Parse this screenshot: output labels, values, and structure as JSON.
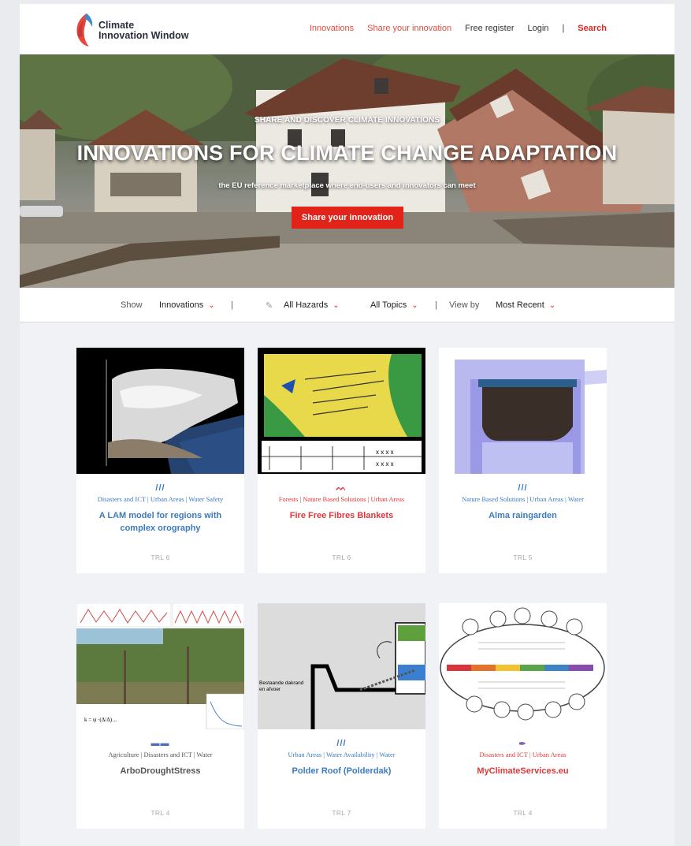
{
  "header": {
    "logo_line1": "Climate",
    "logo_line2": "Innovation Window",
    "nav": {
      "innovations": "Innovations",
      "share": "Share your innovation",
      "register": "Free register",
      "login": "Login",
      "separator": "|",
      "search": "Search"
    }
  },
  "hero": {
    "kicker": "SHARE AND DISCOVER CLIMATE INNOVATIONS",
    "title": "INNOVATIONS FOR CLIMATE CHANGE ADAPTATION",
    "subtitle": "the EU reference marketplace where end-users and innovators can meet",
    "button": "Share your innovation"
  },
  "filters": {
    "show_label": "Show",
    "show_value": "Innovations",
    "separator": "|",
    "hazards_value": "All Hazards",
    "topics_value": "All Topics",
    "view_label": "View by",
    "view_value": "Most Recent",
    "chevron": "⌄"
  },
  "cards": [
    {
      "hazard_icon": "///",
      "tags": "Disasters and ICT | Urban Areas | Water Safety",
      "title": "A LAM model for regions with complex orography",
      "trl": "TRL 6"
    },
    {
      "hazard_icon": "ᨓ",
      "tags": "Forests | Nature Based Solutions | Urban Areas",
      "title": "Fire Free Fibres Blankets",
      "trl": "TRL 6"
    },
    {
      "hazard_icon": "///",
      "tags": "Nature Based Solutions | Urban Areas | Water",
      "title": "Alma raingarden",
      "trl": "TRL 5"
    },
    {
      "hazard_icon": "▬▬",
      "tags": "Agriculture | Disasters and ICT | Water",
      "title": "ArboDroughtStress",
      "trl": "TRL 4"
    },
    {
      "hazard_icon": "///",
      "tags": "Urban Areas | Water Availability | Water",
      "title": "Polder Roof (Polderdak)",
      "trl": "TRL 7"
    },
    {
      "hazard_icon": "✒",
      "tags": "Disasters and ICT | Urban Areas",
      "title": "MyClimateServices.eu",
      "trl": "TRL 4"
    }
  ],
  "thumb_texts": {
    "polder_label_1": "Bestaande dakrand",
    "polder_label_2": "en afvoer"
  },
  "colors": {
    "accent_red": "#e2231a",
    "link_blue": "#3b7bbf",
    "title_red": "#e0373a",
    "background": "#f1f2f5"
  }
}
